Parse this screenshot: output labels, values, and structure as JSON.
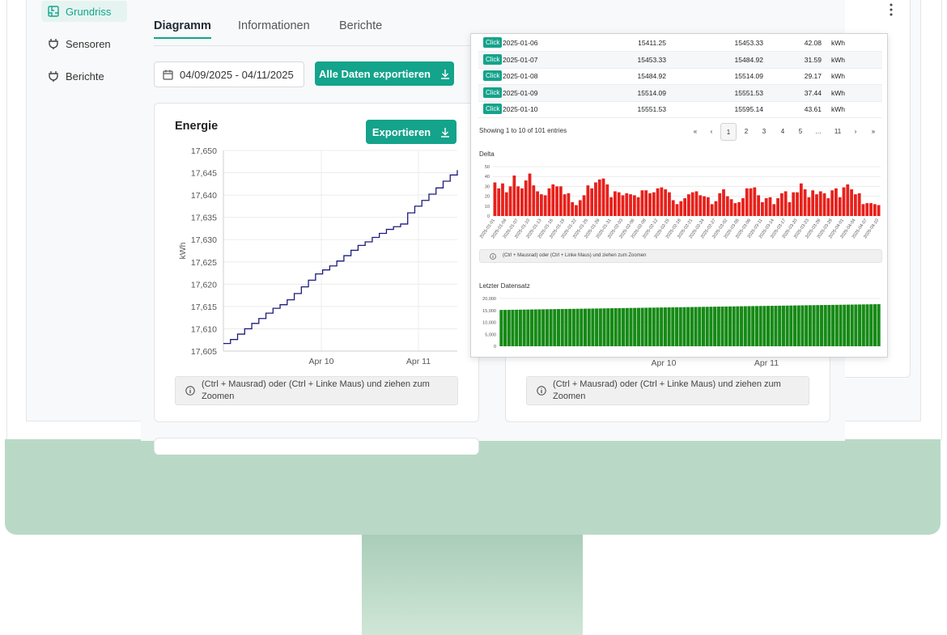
{
  "sidebar": {
    "items": [
      {
        "label": "Grundriss",
        "icon": "floorplan-icon",
        "active": true
      },
      {
        "label": "Sensoren",
        "icon": "plug-icon",
        "active": false
      },
      {
        "label": "Berichte",
        "icon": "plug-icon",
        "active": false
      }
    ]
  },
  "tabs": [
    "Diagramm",
    "Informationen",
    "Berichte"
  ],
  "toolbar": {
    "date_range": "04/09/2025 - 04/11/2025",
    "export_all_label": "Alle Daten exportieren"
  },
  "energy_card": {
    "title": "Energie",
    "export_label": "Exportieren",
    "hint": "(Ctrl + Mausrad) oder (Ctrl + Linke Maus) und ziehen zum Zoomen"
  },
  "second_card": {
    "hint": "(Ctrl + Mausrad) oder (Ctrl + Linke Maus) und ziehen zum Zoomen",
    "x_ticks": [
      "Apr 10",
      "Apr 11"
    ]
  },
  "overlay": {
    "rows": [
      {
        "badge": "Click",
        "date": "2025-01-06",
        "start": "15411.25",
        "end": "15453.33",
        "delta": "42.08",
        "unit": "kWh"
      },
      {
        "badge": "Click",
        "date": "2025-01-07",
        "start": "15453.33",
        "end": "15484.92",
        "delta": "31.59",
        "unit": "kWh"
      },
      {
        "badge": "Click",
        "date": "2025-01-08",
        "start": "15484.92",
        "end": "15514.09",
        "delta": "29.17",
        "unit": "kWh"
      },
      {
        "badge": "Click",
        "date": "2025-01-09",
        "start": "15514.09",
        "end": "15551.53",
        "delta": "37.44",
        "unit": "kWh"
      },
      {
        "badge": "Click",
        "date": "2025-01-10",
        "start": "15551.53",
        "end": "15595.14",
        "delta": "43.61",
        "unit": "kWh"
      }
    ],
    "entries_info": "Showing 1 to 10 of 101 entries",
    "pagination": [
      "«",
      "‹",
      "1",
      "2",
      "3",
      "4",
      "5",
      "…",
      "11",
      "›",
      "»"
    ],
    "current_page": "1",
    "delta_title": "Delta",
    "hint": "(Ctrl + Mausrad) oder (Ctrl + Linke Maus) und ziehen zum Zoomen",
    "last_title": "Letzter Datensatz"
  },
  "chart_data": [
    {
      "type": "line",
      "title": "Energie",
      "ylabel": "kWh",
      "ylim": [
        17605,
        17650
      ],
      "yticks": [
        "17,650",
        "17,645",
        "17,640",
        "17,635",
        "17,630",
        "17,625",
        "17,620",
        "17,615",
        "17,610",
        "17,605"
      ],
      "xticks": [
        "Apr 10",
        "Apr 11"
      ],
      "color": "#1c1c7a",
      "series": [
        {
          "values": [
            17606.7,
            17607.6,
            17608.8,
            17610.0,
            17611.2,
            17612.3,
            17613.5,
            17614.6,
            17615.4,
            17616.5,
            17617.9,
            17619.4,
            17620.9,
            17622.3,
            17623.2,
            17624.1,
            17625.2,
            17626.4,
            17627.6,
            17628.7,
            17629.5,
            17630.5,
            17631.4,
            17632.3,
            17632.9,
            17633.5,
            17636.0,
            17637.5,
            17638.8,
            17640.2,
            17641.6,
            17643.1,
            17644.5,
            17645.6
          ]
        }
      ],
      "x_range_label": "Apr 9 – Apr 11"
    },
    {
      "type": "bar",
      "title": "Delta",
      "ylim": [
        0,
        50
      ],
      "yticks": [
        "50",
        "40",
        "30",
        "20",
        "10",
        "0"
      ],
      "color": "#e8201a",
      "x_start": "2025-01-01",
      "x_end": "2025-04-10",
      "tick_labels": [
        "2025-01-01",
        "2025-01-04",
        "2025-01-07",
        "2025-01-10",
        "2025-01-13",
        "2025-01-16",
        "2025-01-19",
        "2025-01-22",
        "2025-01-25",
        "2025-01-28",
        "2025-01-31",
        "2025-02-03",
        "2025-02-06",
        "2025-02-09",
        "2025-02-12",
        "2025-02-15",
        "2025-02-18",
        "2025-02-21",
        "2025-02-24",
        "2025-02-27",
        "2025-03-02",
        "2025-03-05",
        "2025-03-08",
        "2025-03-11",
        "2025-03-14",
        "2025-03-17",
        "2025-03-20",
        "2025-03-23",
        "2025-03-26",
        "2025-03-29",
        "2025-04-01",
        "2025-04-04",
        "2025-04-07",
        "2025-04-10"
      ],
      "values": [
        34,
        28,
        33,
        24,
        30,
        41,
        30,
        28,
        36,
        43,
        31,
        25,
        22,
        21,
        28,
        32,
        30,
        30,
        22,
        23,
        14,
        11,
        16,
        21,
        31,
        28,
        34,
        37,
        38,
        32,
        19,
        25,
        24,
        21,
        23,
        22,
        21,
        19,
        26,
        26,
        23,
        24,
        28,
        29,
        27,
        24,
        16,
        12,
        15,
        18,
        22,
        24,
        25,
        21,
        20,
        19,
        12,
        15,
        23,
        27,
        20,
        17,
        13,
        14,
        18,
        28,
        28,
        29,
        21,
        14,
        18,
        19,
        12,
        18,
        23,
        25,
        14,
        24,
        24,
        33,
        27,
        19,
        26,
        22,
        25,
        23,
        18,
        26,
        28,
        19,
        29,
        32,
        27,
        22,
        23,
        12,
        13,
        13,
        12,
        11
      ]
    },
    {
      "type": "bar",
      "title": "Letzter Datensatz",
      "ylim": [
        0,
        20000
      ],
      "yticks": [
        "20,000",
        "15,000",
        "10,000",
        "5,000",
        "0"
      ],
      "color": "#168a16",
      "values_start": 15200,
      "values_end": 17620,
      "count": 100
    }
  ]
}
